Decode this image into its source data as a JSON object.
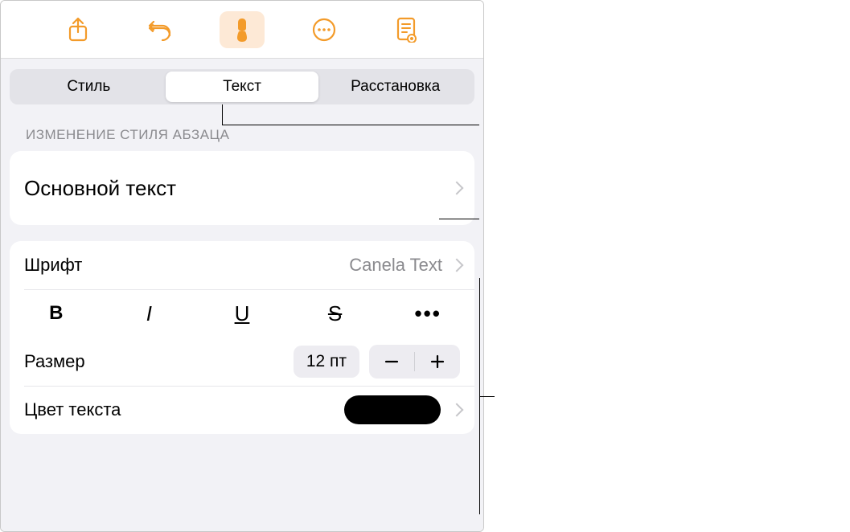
{
  "toolbar": {
    "icons": [
      "share",
      "undo",
      "brush",
      "more",
      "document"
    ]
  },
  "segmented": {
    "style": "Стиль",
    "text": "Текст",
    "layout": "Расстановка"
  },
  "section_header": "ИЗМЕНЕНИЕ СТИЛЯ АБЗАЦА",
  "paragraph_style": {
    "value": "Основной текст"
  },
  "font": {
    "label": "Шрифт",
    "value": "Canela Text"
  },
  "format": {
    "bold": "B",
    "italic": "I",
    "underline": "U",
    "strike": "S",
    "more": "•••"
  },
  "size": {
    "label": "Размер",
    "value": "12 пт"
  },
  "color": {
    "label": "Цвет текста",
    "value": "#000000"
  }
}
